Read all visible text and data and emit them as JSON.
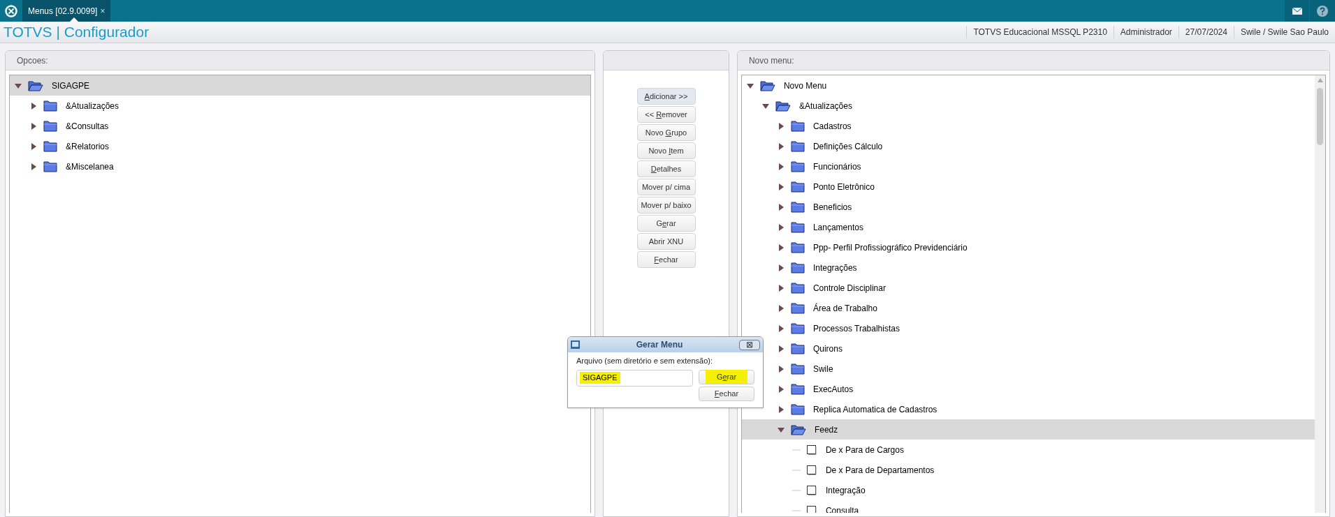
{
  "top_bar": {
    "tab": {
      "label": "Menus [02.9.0099]",
      "close": "×",
      "selected": true
    }
  },
  "header": {
    "title": "TOTVS | Configurador",
    "info": [
      "TOTVS Educacional MSSQL P2310",
      "Administrador",
      "27/07/2024",
      "Swile / Swile Sao Paulo"
    ]
  },
  "options_panel": {
    "title": "Opcoes:",
    "tree": [
      {
        "label": "SIGAGPE",
        "kind": "folder",
        "expanded": true,
        "selected": true,
        "children": [
          {
            "label": "&Atualizações",
            "kind": "folder",
            "expanded": false,
            "selected": false
          },
          {
            "label": "&Consultas",
            "kind": "folder",
            "expanded": false,
            "selected": false
          },
          {
            "label": "&Relatorios",
            "kind": "folder",
            "expanded": false,
            "selected": false
          },
          {
            "label": "&Miscelanea",
            "kind": "folder",
            "expanded": false,
            "selected": false
          }
        ]
      }
    ]
  },
  "actions": [
    {
      "key": "A",
      "post": "dicionar >>",
      "selected": true
    },
    {
      "pre": "<< ",
      "key": "R",
      "post": "emover",
      "selected": false
    },
    {
      "pre": "Novo ",
      "key": "G",
      "post": "rupo",
      "selected": false
    },
    {
      "pre": "Novo ",
      "key": "I",
      "post": "tem",
      "selected": false
    },
    {
      "key": "D",
      "post": "etalhes",
      "selected": false
    },
    {
      "pre": "Mover p/ cima",
      "selected": false
    },
    {
      "pre": "Mover p/ baixo",
      "selected": false
    },
    {
      "pre": "G",
      "key": "e",
      "post": "rar",
      "selected": false
    },
    {
      "pre": "Abrir XNU",
      "selected": false
    },
    {
      "key": "F",
      "post": "echar",
      "selected": false
    }
  ],
  "new_menu_panel": {
    "title": "Novo menu:",
    "tree": [
      {
        "label": "Novo Menu",
        "kind": "folder",
        "expanded": true,
        "selected": false,
        "children": [
          {
            "label": "&Atualizações",
            "kind": "folder",
            "expanded": true,
            "selected": false,
            "children": [
              {
                "label": "Cadastros",
                "kind": "folder",
                "expanded": false,
                "selected": false
              },
              {
                "label": "Definições Cálculo",
                "kind": "folder",
                "expanded": false,
                "selected": false
              },
              {
                "label": "Funcionários",
                "kind": "folder",
                "expanded": false,
                "selected": false
              },
              {
                "label": "Ponto Eletrônico",
                "kind": "folder",
                "expanded": false,
                "selected": false
              },
              {
                "label": "Beneficios",
                "kind": "folder",
                "expanded": false,
                "selected": false
              },
              {
                "label": "Lançamentos",
                "kind": "folder",
                "expanded": false,
                "selected": false
              },
              {
                "label": "Ppp- Perfil Profissiográfico Previdenciário",
                "kind": "folder",
                "expanded": false,
                "selected": false
              },
              {
                "label": "Integrações",
                "kind": "folder",
                "expanded": false,
                "selected": false
              },
              {
                "label": "Controle Disciplinar",
                "kind": "folder",
                "expanded": false,
                "selected": false
              },
              {
                "label": "Área de Trabalho",
                "kind": "folder",
                "expanded": false,
                "selected": false
              },
              {
                "label": "Processos Trabalhistas",
                "kind": "folder",
                "expanded": false,
                "selected": false
              },
              {
                "label": "Quirons",
                "kind": "folder",
                "expanded": false,
                "selected": false
              },
              {
                "label": "Swile",
                "kind": "folder",
                "expanded": false,
                "selected": false
              },
              {
                "label": "ExecAutos",
                "kind": "folder",
                "expanded": false,
                "selected": false
              },
              {
                "label": "Replica Automatica de Cadastros",
                "kind": "folder",
                "expanded": false,
                "selected": false
              },
              {
                "label": "Feedz",
                "kind": "folder",
                "expanded": true,
                "selected": true,
                "children": [
                  {
                    "label": "De x Para de Cargos",
                    "kind": "item",
                    "selected": false
                  },
                  {
                    "label": "De x Para de Departamentos",
                    "kind": "item",
                    "selected": false
                  },
                  {
                    "label": "Integração",
                    "kind": "item",
                    "selected": false
                  },
                  {
                    "label": "Consulta",
                    "kind": "item",
                    "selected": false
                  }
                ]
              }
            ]
          }
        ]
      }
    ]
  },
  "dialog": {
    "title": "Gerar Menu",
    "close": "⊠",
    "prompt": "Arquivo (sem diretório e sem extensão):",
    "field": {
      "value": "SIGAGPE",
      "highlighted": true
    },
    "buttons": [
      {
        "pre": "G",
        "key": "e",
        "post": "rar",
        "highlighted": true
      },
      {
        "key": "F",
        "post": "echar",
        "highlighted": false
      }
    ]
  }
}
